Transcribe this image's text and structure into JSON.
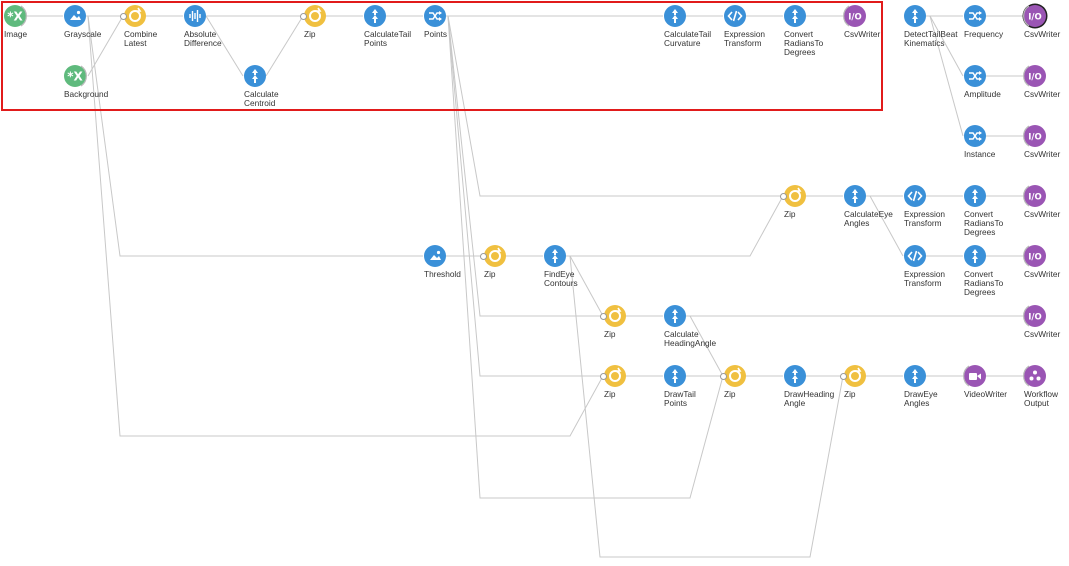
{
  "colors": {
    "source": "#5fba7d",
    "transform": "#3a90d8",
    "combinator": "#f0c040",
    "sink": "#9a55b4",
    "wire": "#c8c8c8",
    "selection": "#e11b1b"
  },
  "nodes": [
    {
      "id": "image",
      "kind": "source",
      "icon": "source-x-icon",
      "label": "Image"
    },
    {
      "id": "grayscale",
      "kind": "transform",
      "icon": "image-icon",
      "label": "Grayscale"
    },
    {
      "id": "background",
      "kind": "source",
      "icon": "source-x-icon",
      "label": "Background"
    },
    {
      "id": "combine-latest",
      "kind": "combinator",
      "icon": "combine-icon",
      "label": "Combine\nLatest"
    },
    {
      "id": "absolute-difference",
      "kind": "transform",
      "icon": "waveform-icon",
      "label": "Absolute\nDifference"
    },
    {
      "id": "calculate-centroid",
      "kind": "transform",
      "icon": "transform-arrow-icon",
      "label": "Calculate\nCentroid"
    },
    {
      "id": "zip-1",
      "kind": "combinator",
      "icon": "combine-icon",
      "label": "Zip"
    },
    {
      "id": "calculate-tail-points",
      "kind": "transform",
      "icon": "transform-arrow-icon",
      "label": "CalculateTail\nPoints"
    },
    {
      "id": "points",
      "kind": "transform",
      "icon": "shuffle-icon",
      "label": "Points"
    },
    {
      "id": "calculate-tail-curvature",
      "kind": "transform",
      "icon": "transform-arrow-icon",
      "label": "CalculateTail\nCurvature"
    },
    {
      "id": "expression-transform-1",
      "kind": "transform",
      "icon": "code-icon",
      "label": "Expression\nTransform"
    },
    {
      "id": "convert-radians-1",
      "kind": "transform",
      "icon": "transform-arrow-icon",
      "label": "Convert\nRadiansTo\nDegrees"
    },
    {
      "id": "csvwriter-1",
      "kind": "sink",
      "icon": "io-icon",
      "label": "CsvWriter"
    },
    {
      "id": "detect-tail-beat",
      "kind": "transform",
      "icon": "transform-arrow-icon",
      "label": "DetectTailBeat\nKinematics"
    },
    {
      "id": "frequency",
      "kind": "transform",
      "icon": "shuffle-icon",
      "label": "Frequency"
    },
    {
      "id": "csvwriter-2",
      "kind": "sink",
      "icon": "io-icon",
      "label": "CsvWriter",
      "highlight": true
    },
    {
      "id": "amplitude",
      "kind": "transform",
      "icon": "shuffle-icon",
      "label": "Amplitude"
    },
    {
      "id": "csvwriter-3",
      "kind": "sink",
      "icon": "io-icon",
      "label": "CsvWriter"
    },
    {
      "id": "instance",
      "kind": "transform",
      "icon": "shuffle-icon",
      "label": "Instance"
    },
    {
      "id": "csvwriter-4",
      "kind": "sink",
      "icon": "io-icon",
      "label": "CsvWriter"
    },
    {
      "id": "zip-2",
      "kind": "combinator",
      "icon": "combine-icon",
      "label": "Zip"
    },
    {
      "id": "calculate-eye-angles",
      "kind": "transform",
      "icon": "transform-arrow-icon",
      "label": "CalculateEye\nAngles"
    },
    {
      "id": "expression-transform-2",
      "kind": "transform",
      "icon": "code-icon",
      "label": "Expression\nTransform"
    },
    {
      "id": "convert-radians-2",
      "kind": "transform",
      "icon": "transform-arrow-icon",
      "label": "Convert\nRadiansTo\nDegrees"
    },
    {
      "id": "csvwriter-5",
      "kind": "sink",
      "icon": "io-icon",
      "label": "CsvWriter"
    },
    {
      "id": "expression-transform-3",
      "kind": "transform",
      "icon": "code-icon",
      "label": "Expression\nTransform"
    },
    {
      "id": "convert-radians-3",
      "kind": "transform",
      "icon": "transform-arrow-icon",
      "label": "Convert\nRadiansTo\nDegrees"
    },
    {
      "id": "csvwriter-6",
      "kind": "sink",
      "icon": "io-icon",
      "label": "CsvWriter"
    },
    {
      "id": "threshold",
      "kind": "transform",
      "icon": "image-icon",
      "label": "Threshold"
    },
    {
      "id": "zip-3",
      "kind": "combinator",
      "icon": "combine-icon",
      "label": "Zip"
    },
    {
      "id": "find-eye-contours",
      "kind": "transform",
      "icon": "transform-arrow-icon",
      "label": "FindEye\nContours"
    },
    {
      "id": "zip-4",
      "kind": "combinator",
      "icon": "combine-icon",
      "label": "Zip"
    },
    {
      "id": "calculate-heading-angle",
      "kind": "transform",
      "icon": "transform-arrow-icon",
      "label": "Calculate\nHeadingAngle"
    },
    {
      "id": "csvwriter-7",
      "kind": "sink",
      "icon": "io-icon",
      "label": "CsvWriter"
    },
    {
      "id": "zip-5",
      "kind": "combinator",
      "icon": "combine-icon",
      "label": "Zip"
    },
    {
      "id": "draw-tail-points",
      "kind": "transform",
      "icon": "transform-arrow-icon",
      "label": "DrawTail\nPoints"
    },
    {
      "id": "zip-6",
      "kind": "combinator",
      "icon": "combine-icon",
      "label": "Zip"
    },
    {
      "id": "draw-heading-angle",
      "kind": "transform",
      "icon": "transform-arrow-icon",
      "label": "DrawHeading\nAngle"
    },
    {
      "id": "zip-7",
      "kind": "combinator",
      "icon": "combine-icon",
      "label": "Zip"
    },
    {
      "id": "draw-eye-angles",
      "kind": "transform",
      "icon": "transform-arrow-icon",
      "label": "DrawEye\nAngles"
    },
    {
      "id": "video-writer",
      "kind": "sink",
      "icon": "video-camera-icon",
      "label": "VideoWriter"
    },
    {
      "id": "workflow-output",
      "kind": "sink",
      "icon": "workflow-output-icon",
      "label": "Workflow\nOutput"
    }
  ]
}
